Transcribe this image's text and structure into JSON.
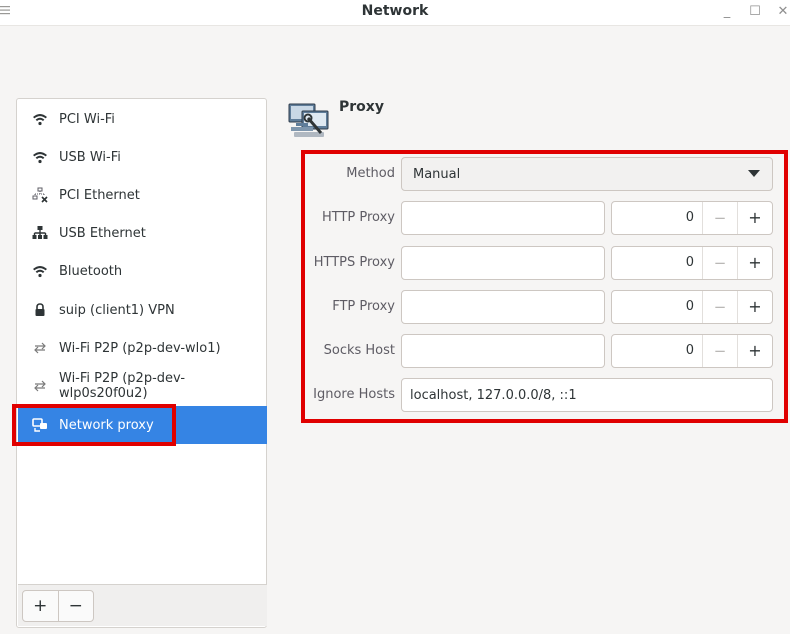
{
  "window": {
    "title": "Network",
    "menu_icon": "hamburger-icon",
    "minimize_glyph": "_",
    "maximize_glyph": "☐",
    "close_glyph": "✕"
  },
  "sidebar": {
    "items": [
      {
        "label": "PCI Wi-Fi",
        "icon": "wifi-icon"
      },
      {
        "label": "USB Wi-Fi",
        "icon": "wifi-icon"
      },
      {
        "label": "PCI Ethernet",
        "icon": "ethernet-disconnected-icon"
      },
      {
        "label": "USB Ethernet",
        "icon": "ethernet-icon"
      },
      {
        "label": "Bluetooth",
        "icon": "wifi-icon"
      },
      {
        "label": "suip (client1) VPN",
        "icon": "lock-icon"
      },
      {
        "label": "Wi-Fi P2P (p2p-dev-wlo1)",
        "icon": "arrows-icon"
      },
      {
        "label": "Wi-Fi P2P (p2p-dev-wlp0s20f0u2)",
        "icon": "arrows-icon"
      },
      {
        "label": "Network proxy",
        "icon": "network-proxy-icon",
        "selected": true
      }
    ],
    "add_label": "+",
    "remove_label": "−"
  },
  "proxy": {
    "title": "Proxy",
    "method_label": "Method",
    "method_value": "Manual",
    "rows": [
      {
        "label": "HTTP Proxy",
        "host": "",
        "port": "0"
      },
      {
        "label": "HTTPS Proxy",
        "host": "",
        "port": "0"
      },
      {
        "label": "FTP Proxy",
        "host": "",
        "port": "0"
      },
      {
        "label": "Socks Host",
        "host": "",
        "port": "0"
      }
    ],
    "ignore_label": "Ignore Hosts",
    "ignore_value": "localhost, 127.0.0.0/8, ::1",
    "spin_minus": "−",
    "spin_plus": "+"
  },
  "colors": {
    "accent": "#3584e4",
    "highlight": "#e00000"
  }
}
